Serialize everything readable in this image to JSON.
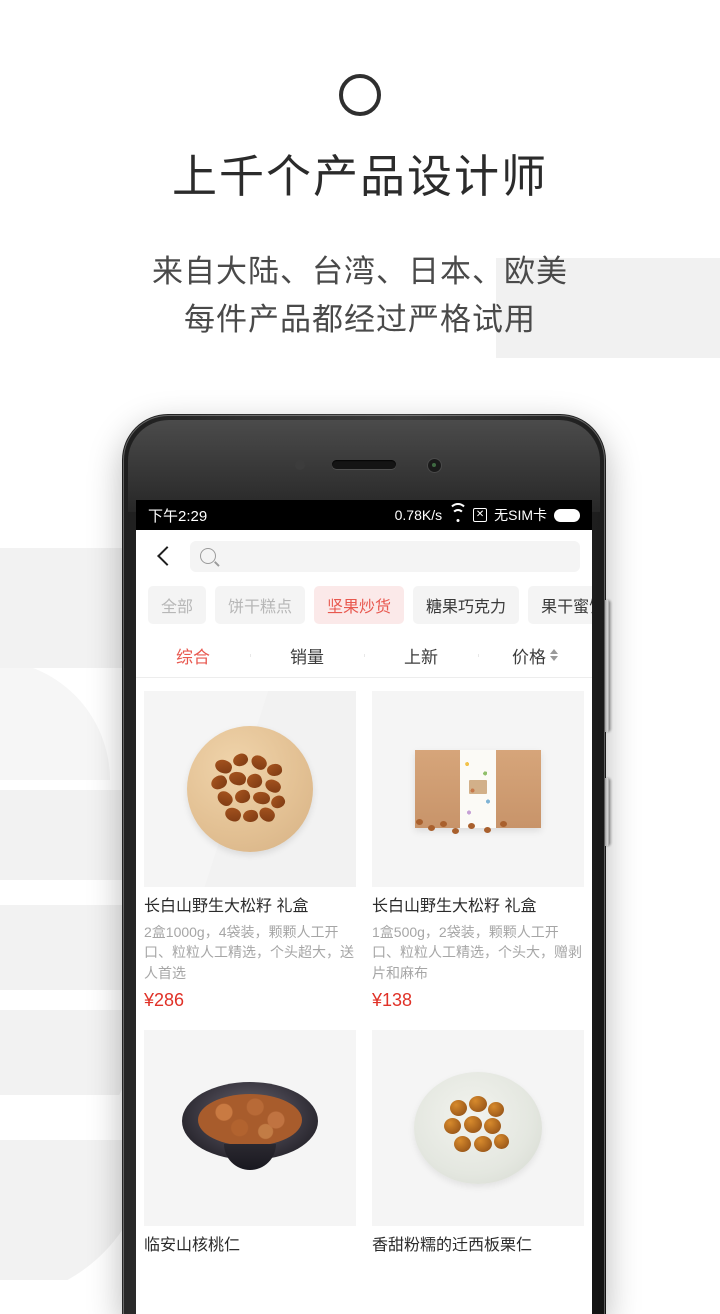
{
  "promo": {
    "logo_icon": "ring-logo-icon",
    "headline": "上千个产品设计师",
    "subline_1": "来自大陆、台湾、日本、欧美",
    "subline_2": "每件产品都经过严格试用"
  },
  "phone": {
    "statusbar": {
      "time": "下午2:29",
      "network_speed": "0.78K/s",
      "wifi_icon": "wifi-icon",
      "no_signal_icon": "signal-x-icon",
      "sim_label": "无SIM卡",
      "battery_icon": "battery-icon"
    },
    "navbar": {
      "back_icon": "back-chevron-icon",
      "search_icon": "search-icon",
      "search_value": "",
      "search_placeholder": ""
    },
    "categories": [
      {
        "label": "全部",
        "state": "muted"
      },
      {
        "label": "饼干糕点",
        "state": "muted"
      },
      {
        "label": "坚果炒货",
        "state": "active"
      },
      {
        "label": "糖果巧克力",
        "state": "normal"
      },
      {
        "label": "果干蜜饯",
        "state": "normal"
      }
    ],
    "sort_tabs": [
      {
        "label": "综合",
        "active": true,
        "has_arrows": false
      },
      {
        "label": "销量",
        "active": false,
        "has_arrows": false
      },
      {
        "label": "上新",
        "active": false,
        "has_arrows": false
      },
      {
        "label": "价格",
        "active": false,
        "has_arrows": true
      }
    ],
    "products": [
      {
        "image": "pine-nuts-on-wooden-plate",
        "title": "长白山野生大松籽 礼盒",
        "desc": "2盒1000g，4袋装，颗颗人工开口、粒粒人工精选，个头超大，送人首选",
        "price": "¥286"
      },
      {
        "image": "kraft-gift-box",
        "title": "长白山野生大松籽 礼盒",
        "desc": "1盒500g，2袋装，颗颗人工开口、粒粒人工精选，个头大，赠剥片和麻布",
        "price": "¥138"
      },
      {
        "image": "walnut-kernels-in-dark-bowl",
        "title": "临安山核桃仁",
        "desc": "",
        "price": ""
      },
      {
        "image": "chestnuts-on-pale-plate",
        "title": "香甜粉糯的迁西板栗仁",
        "desc": "",
        "price": ""
      }
    ]
  },
  "colors": {
    "accent_red": "#e8584f",
    "price_red": "#e03127",
    "chip_active_bg": "#fbe9e9",
    "chip_bg": "#f4f4f4",
    "text_dark": "#2b2b2b",
    "text_muted": "#a6a6a6"
  }
}
